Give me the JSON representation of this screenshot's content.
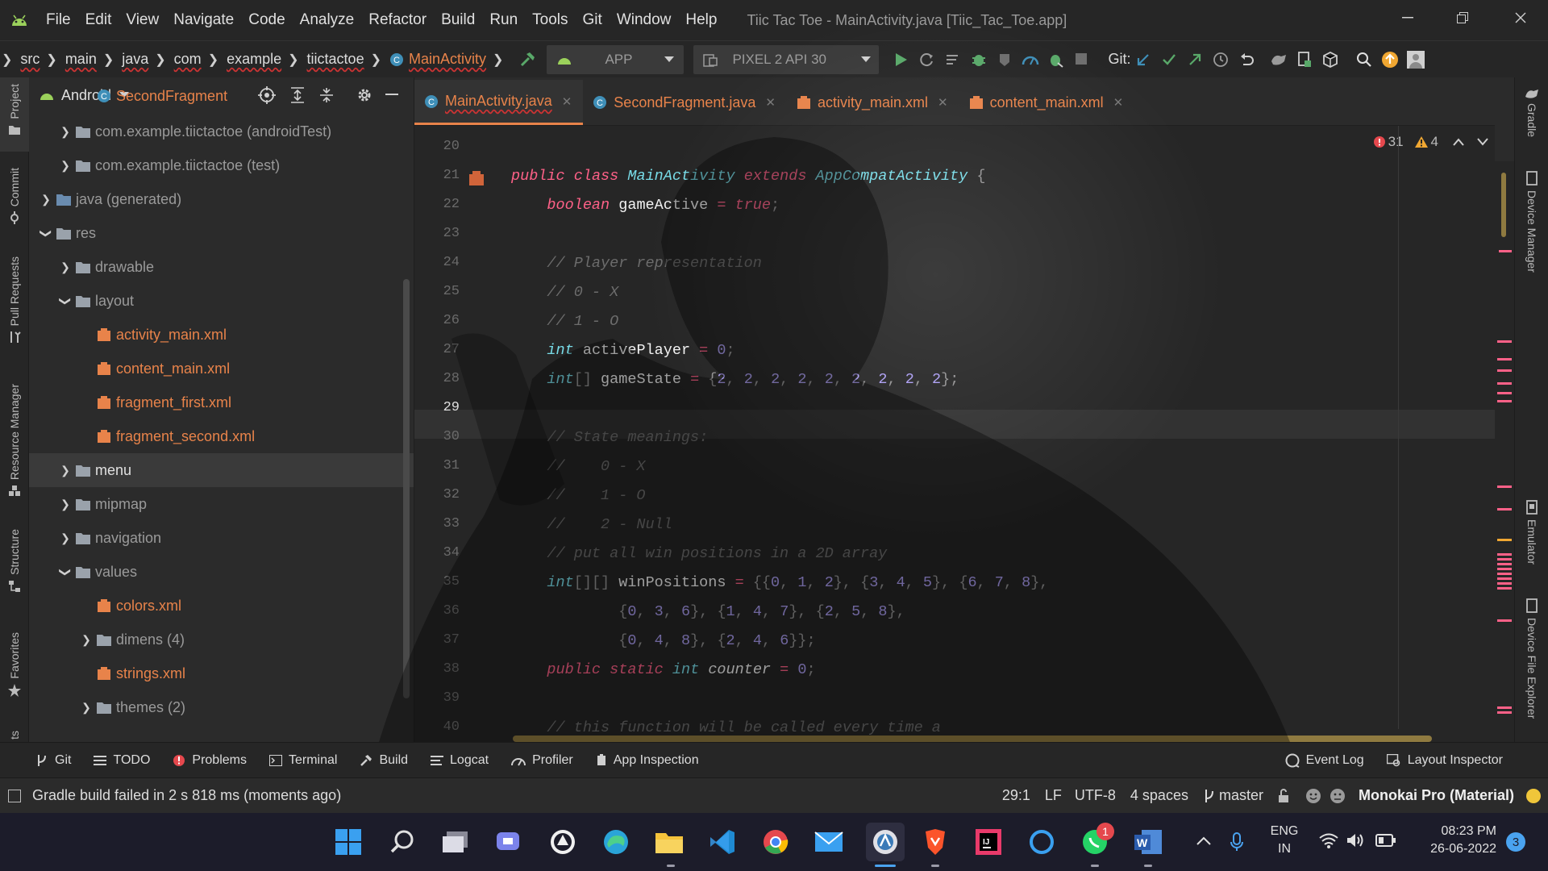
{
  "menubar": {
    "items": [
      "File",
      "Edit",
      "View",
      "Navigate",
      "Code",
      "Analyze",
      "Refactor",
      "Build",
      "Run",
      "Tools",
      "Git",
      "Window",
      "Help"
    ],
    "window_title": "Tiic Tac Toe - MainActivity.java [Tiic_Tac_Toe.app]"
  },
  "breadcrumb": [
    "src",
    "main",
    "java",
    "com",
    "example",
    "tiictactoe",
    "MainActivity"
  ],
  "toolbar": {
    "run_config": "APP",
    "device": "PIXEL 2 API 30",
    "git_label": "Git:"
  },
  "left_strip": [
    "Project",
    "Commit",
    "Pull Requests",
    "Resource Manager",
    "Structure",
    "Favorites",
    "ts"
  ],
  "right_strip": [
    "Gradle",
    "Device Manager",
    "Emulator",
    "Device File Explorer"
  ],
  "project_panel": {
    "view": "Android",
    "tree": [
      {
        "label": "SecondFragment",
        "kind": "class"
      },
      {
        "label": "com.example.tiictactoe (androidTest)",
        "kind": "folder",
        "dim": true
      },
      {
        "label": "com.example.tiictactoe (test)",
        "kind": "folder",
        "dim": true
      },
      {
        "label": "java (generated)",
        "kind": "folder",
        "dim": true
      },
      {
        "label": "res",
        "kind": "folder",
        "dim": true
      },
      {
        "label": "drawable",
        "kind": "folder",
        "dim": true
      },
      {
        "label": "layout",
        "kind": "folder",
        "dim": true
      },
      {
        "label": "activity_main.xml",
        "kind": "xml"
      },
      {
        "label": "content_main.xml",
        "kind": "xml"
      },
      {
        "label": "fragment_first.xml",
        "kind": "xml"
      },
      {
        "label": "fragment_second.xml",
        "kind": "xml"
      },
      {
        "label": "menu",
        "kind": "folder",
        "dim": true
      },
      {
        "label": "mipmap",
        "kind": "folder",
        "dim": true
      },
      {
        "label": "navigation",
        "kind": "folder",
        "dim": true
      },
      {
        "label": "values",
        "kind": "folder",
        "dim": true
      },
      {
        "label": "colors.xml",
        "kind": "xml"
      },
      {
        "label": "dimens (4)",
        "kind": "folder",
        "dim": true
      },
      {
        "label": "strings.xml",
        "kind": "xml"
      },
      {
        "label": "themes (2)",
        "kind": "folder",
        "dim": true
      }
    ]
  },
  "editor": {
    "tabs": [
      "MainActivity.java",
      "SecondFragment.java",
      "activity_main.xml",
      "content_main.xml"
    ],
    "active_tab": 0,
    "errors": "31",
    "warnings": "4",
    "line_numbers": [
      "20",
      "21",
      "22",
      "23",
      "24",
      "25",
      "26",
      "27",
      "28",
      "29",
      "30",
      "31",
      "32",
      "33",
      "34",
      "35",
      "36",
      "37",
      "38",
      "39",
      "40"
    ],
    "current_line": "29"
  },
  "bottom_tools": [
    "Git",
    "TODO",
    "Problems",
    "Terminal",
    "Build",
    "Logcat",
    "Profiler",
    "App Inspection",
    "Event Log",
    "Layout Inspector"
  ],
  "statusbar": {
    "message": "Gradle build failed in 2 s 818 ms (moments ago)",
    "position": "29:1",
    "line_sep": "LF",
    "encoding": "UTF-8",
    "indent": "4 spaces",
    "branch": "master",
    "theme": "Monokai Pro (Material)"
  },
  "taskbar": {
    "lang_top": "ENG",
    "lang_bottom": "IN",
    "time": "08:23 PM",
    "date": "26-06-2022",
    "notif_count": "3",
    "whatsapp_badge": "1"
  },
  "colors": {
    "keyword": "#ff6188",
    "type": "#78dce8",
    "number": "#ab9df2",
    "comment": "#6c6c6c",
    "xml": "#e8834a"
  }
}
